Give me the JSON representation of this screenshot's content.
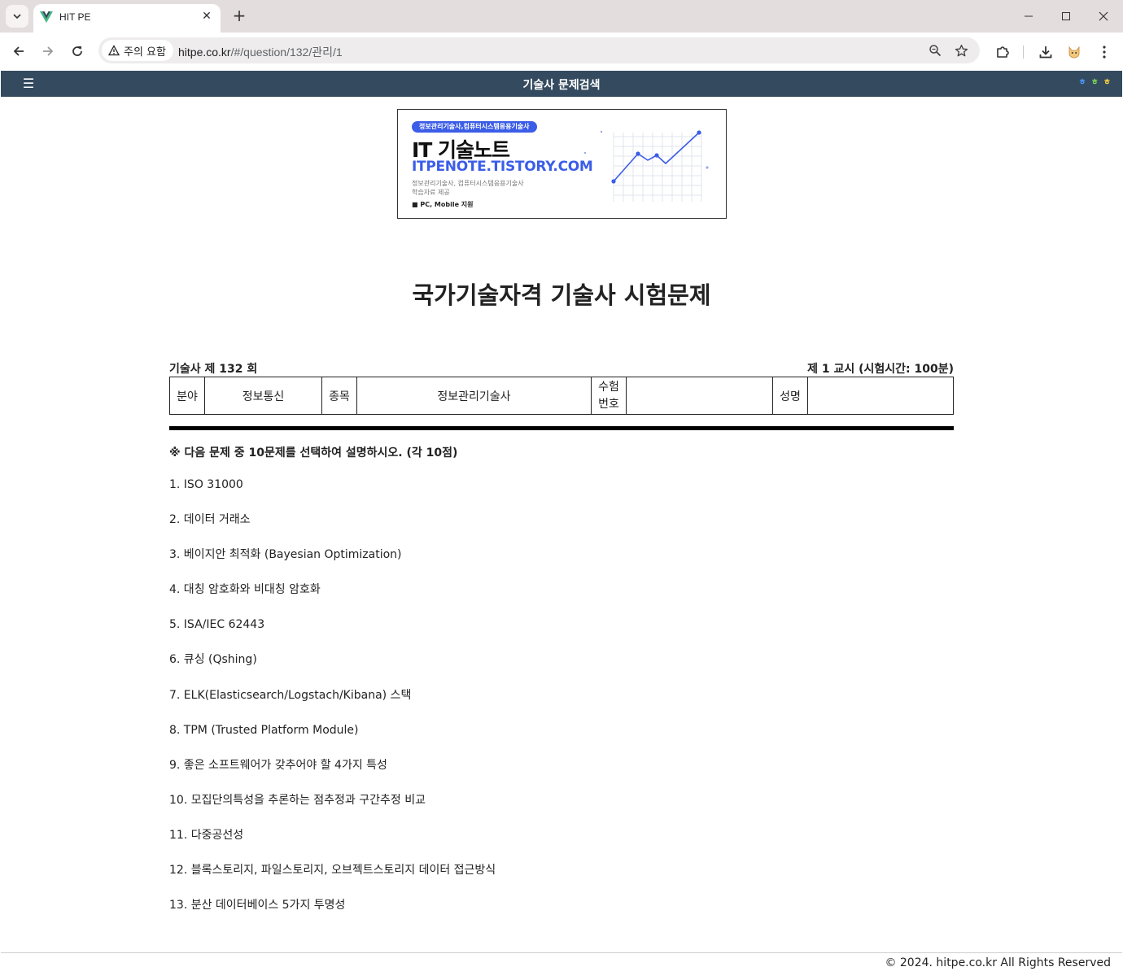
{
  "browser": {
    "tab_title": "HIT PE",
    "security_label": "주의 요함",
    "url_host": "hitpe.co.kr",
    "url_path": "/#/question/132/관리/1"
  },
  "header": {
    "title": "기술사 문제검색",
    "dots": [
      {
        "char": "ㅎ",
        "color": "#4a9cff"
      },
      {
        "char": "ㅎ",
        "color": "#7ed957"
      },
      {
        "char": "ㅎ",
        "color": "#ffd23f"
      }
    ]
  },
  "banner": {
    "pill": "정보관리기술사,컴퓨터시스템응용기술사",
    "title": "IT 기술노트",
    "url": "ITPENOTE.TISTORY.COM",
    "sub_line1": "정보관리기술사, 컴퓨터시스템응용기술사",
    "sub_line2": "학습자료 제공",
    "support": "■ PC, Mobile 지원"
  },
  "main": {
    "page_title": "국가기술자격 기술사 시험문제",
    "exam_round": "기술사 제 132 회",
    "exam_period": "제 1 교시 (시험시간: 100분)",
    "info_table": {
      "field_label": "분야",
      "field_value": "정보통신",
      "category_label": "종목",
      "category_value": "정보관리기술사",
      "exam_no_label_1": "수험",
      "exam_no_label_2": "번호",
      "exam_no_value": "",
      "name_label": "성명",
      "name_value": ""
    },
    "instruction": "※ 다음 문제 중 10문제를 선택하여 설명하시오. (각 10점)",
    "questions": [
      "1. ISO 31000",
      "2. 데이터 거래소",
      "3. 베이지안 최적화 (Bayesian Optimization)",
      "4. 대칭 암호화와 비대칭 암호화",
      "5. ISA/IEC 62443",
      "6. 큐싱 (Qshing)",
      "7. ELK(Elasticsearch/Logstach/Kibana) 스택",
      "8. TPM (Trusted Platform Module)",
      "9. 좋은 소프트웨어가 갖추어야 할 4가지 특성",
      "10. 모집단의특성을 추론하는 점추정과 구간추정 비교",
      "11. 다중공선성",
      "12. 블록스토리지, 파일스토리지, 오브젝트스토리지 데이터 접근방식",
      "13. 분산 데이터베이스 5가지 투명성"
    ]
  },
  "footer": {
    "text": "© 2024. hitpe.co.kr All Rights Reserved"
  }
}
